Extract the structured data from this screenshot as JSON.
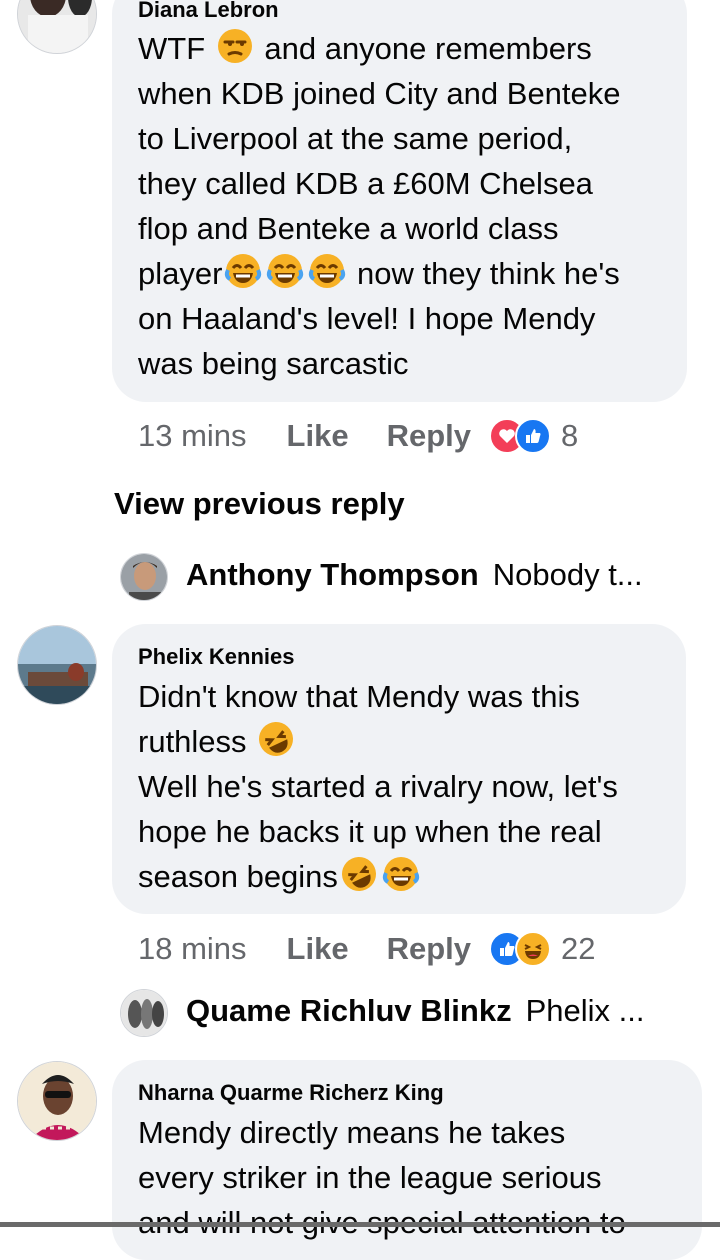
{
  "comments": [
    {
      "author": "Diana Lebron",
      "text_parts": [
        "WTF ",
        " and anyone remembers\nwhen KDB joined City and Benteke\nto Liverpool at the same period,\nthey called KDB a £60M Chelsea\nflop and Benteke a world class\nplayer",
        " now they think he's\non Haaland's level! I hope Mendy\nwas being sarcastic"
      ],
      "time": "13 mins",
      "like_label": "Like",
      "reply_label": "Reply",
      "reactions": [
        "love-reaction-icon",
        "like-reaction-icon"
      ],
      "reaction_count": "8"
    },
    {
      "author": "Phelix Kennies",
      "text_parts": [
        "Didn't know that Mendy was this\nruthless ",
        "\nWell he's started a rivalry now, let's\nhope he backs it up when the real\nseason  begins"
      ],
      "time": "18 mins",
      "like_label": "Like",
      "reply_label": "Reply",
      "reactions": [
        "like-reaction-icon",
        "haha-reaction-icon"
      ],
      "reaction_count": "22"
    },
    {
      "author": "Nharna Quarme Richerz King",
      "text": "Mendy directly means he takes\nevery striker in the league serious\nand will not give special attention to"
    }
  ],
  "view_previous_label": "View previous reply",
  "reply_previews": [
    {
      "name": "Anthony Thompson",
      "snippet": "Nobody t..."
    },
    {
      "name": "Quame Richluv Blinkz",
      "snippet": "Phelix ..."
    }
  ],
  "colors": {
    "bubble": "#f0f2f5",
    "meta_text": "#65676b",
    "love_red": "#f33e58",
    "like_blue": "#1877f2",
    "haha_yellow": "#f7b125"
  }
}
